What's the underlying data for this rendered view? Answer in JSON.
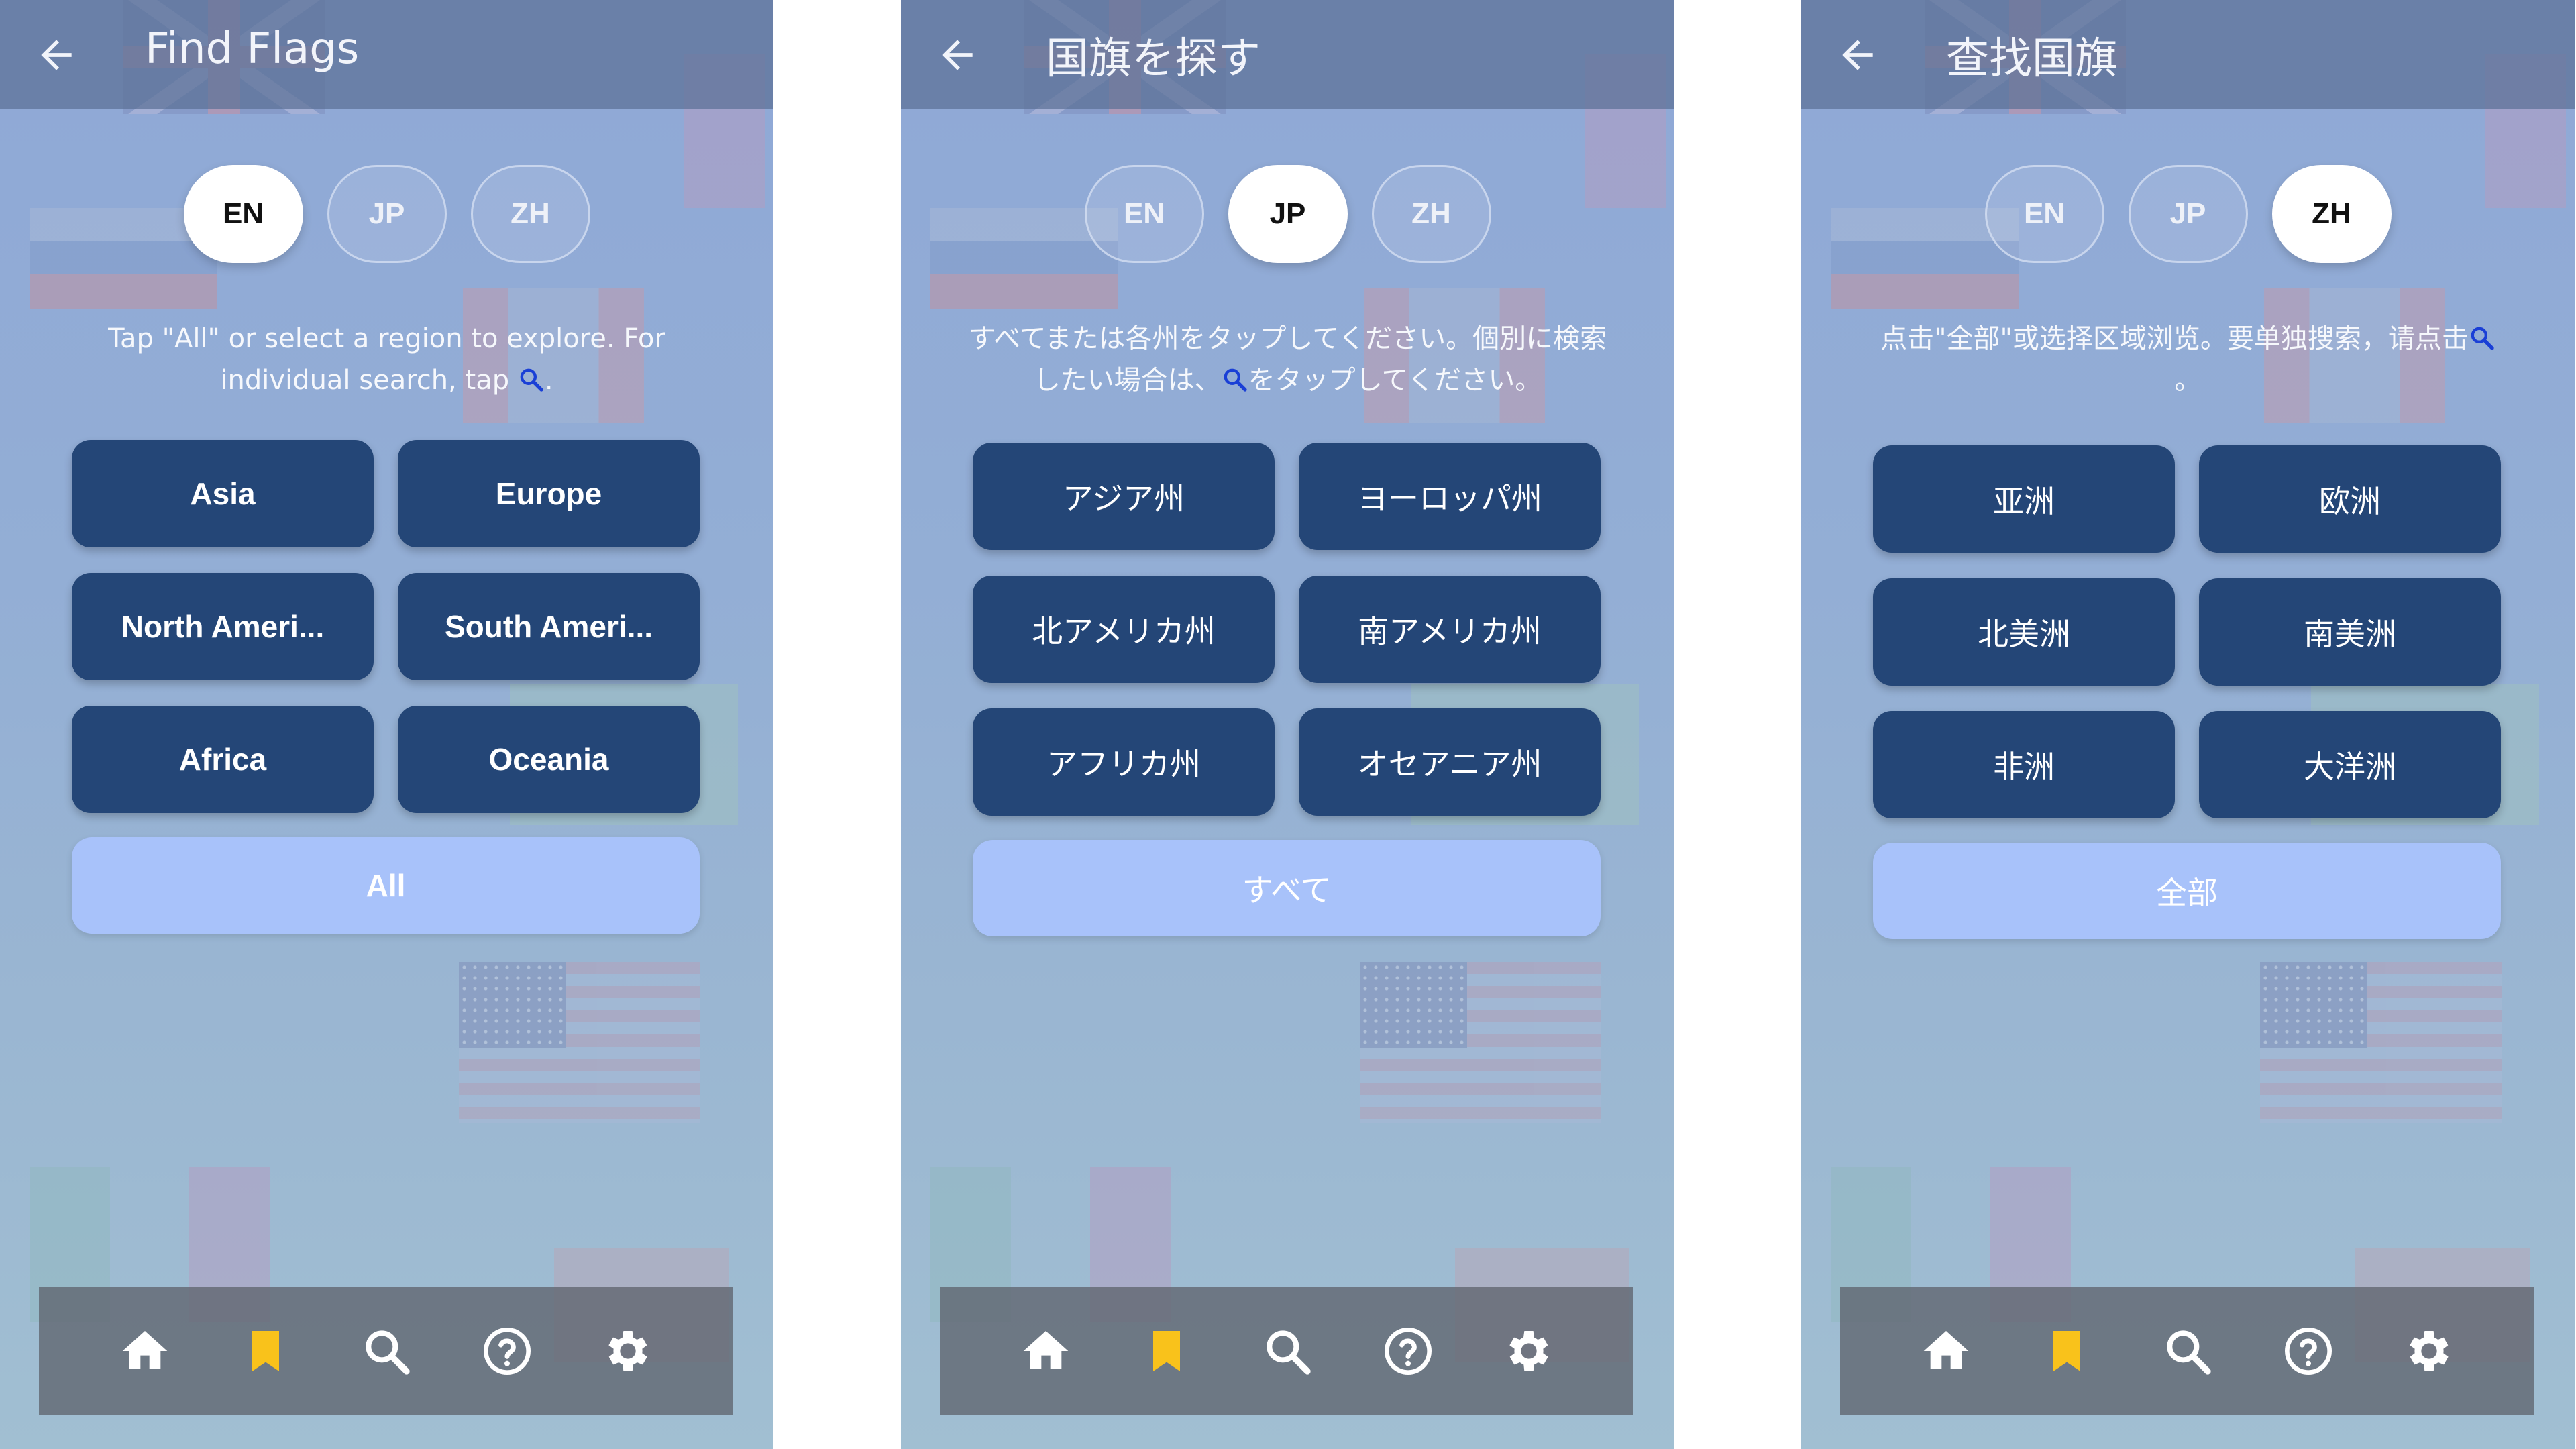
{
  "screens": [
    {
      "title": "Find Flags",
      "lang_buttons": [
        "EN",
        "JP",
        "ZH"
      ],
      "active_lang": "EN",
      "hint_before_icon": "Tap \"All\" or select a region to explore. For individual search, tap ",
      "hint_after_icon": ".",
      "regions": [
        "Asia",
        "Europe",
        "North Ameri...",
        "South Ameri...",
        "Africa",
        "Oceania"
      ],
      "all_label": "All"
    },
    {
      "title": "国旗を探す",
      "lang_buttons": [
        "EN",
        "JP",
        "ZH"
      ],
      "active_lang": "JP",
      "hint_before_icon": "すべてまたは各州をタップしてください。個別に検索したい場合は、",
      "hint_after_icon": "をタップしてください。",
      "regions": [
        "アジア州",
        "ヨーロッパ州",
        "北アメリカ州",
        "南アメリカ州",
        "アフリカ州",
        "オセアニア州"
      ],
      "all_label": "すべて"
    },
    {
      "title": "查找国旗",
      "lang_buttons": [
        "EN",
        "JP",
        "ZH"
      ],
      "active_lang": "ZH",
      "hint_before_icon": "点击\"全部\"或选择区域浏览。要单独搜索，请点击",
      "hint_after_icon": "。",
      "regions": [
        "亚洲",
        "欧洲",
        "北美洲",
        "南美洲",
        "非洲",
        "大洋洲"
      ],
      "all_label": "全部"
    }
  ],
  "navbar": {
    "icons": [
      "home-icon",
      "bookmark-icon",
      "search-icon",
      "help-icon",
      "settings-icon"
    ],
    "bookmark_color": "#f9c21b",
    "icon_color": "#ffffff"
  },
  "colors": {
    "region_button": "#244677",
    "all_button": "#a8c2fa",
    "appbar": "#5c7096",
    "navbar": "#5f646e"
  }
}
